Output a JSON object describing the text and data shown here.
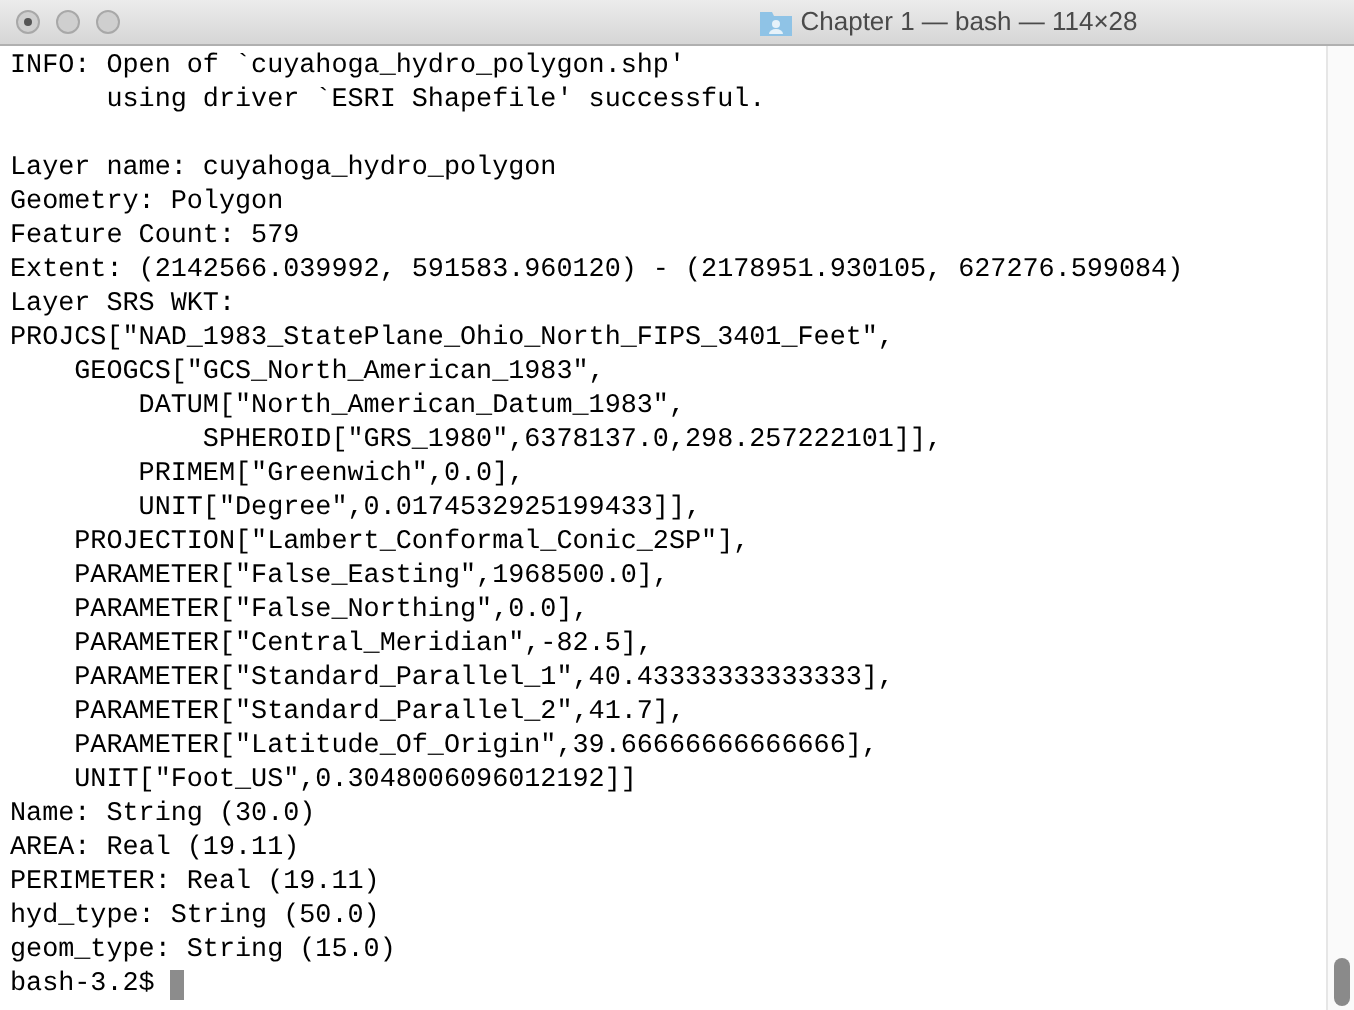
{
  "window": {
    "title": "Chapter 1 — bash — 114×28"
  },
  "terminal": {
    "blocks": [
      [
        "INFO: Open of `cuyahoga_hydro_polygon.shp'",
        "      using driver `ESRI Shapefile' successful."
      ],
      [
        "Layer name: cuyahoga_hydro_polygon",
        "Geometry: Polygon",
        "Feature Count: 579",
        "Extent: (2142566.039992, 591583.960120) - (2178951.930105, 627276.599084)",
        "Layer SRS WKT:",
        "PROJCS[\"NAD_1983_StatePlane_Ohio_North_FIPS_3401_Feet\",",
        "    GEOGCS[\"GCS_North_American_1983\",",
        "        DATUM[\"North_American_Datum_1983\",",
        "            SPHEROID[\"GRS_1980\",6378137.0,298.257222101]],",
        "        PRIMEM[\"Greenwich\",0.0],",
        "        UNIT[\"Degree\",0.0174532925199433]],",
        "    PROJECTION[\"Lambert_Conformal_Conic_2SP\"],",
        "    PARAMETER[\"False_Easting\",1968500.0],",
        "    PARAMETER[\"False_Northing\",0.0],",
        "    PARAMETER[\"Central_Meridian\",-82.5],",
        "    PARAMETER[\"Standard_Parallel_1\",40.43333333333333],",
        "    PARAMETER[\"Standard_Parallel_2\",41.7],",
        "    PARAMETER[\"Latitude_Of_Origin\",39.66666666666666],",
        "    UNIT[\"Foot_US\",0.3048006096012192]]",
        "Name: String (30.0)",
        "AREA: Real (19.11)",
        "PERIMETER: Real (19.11)",
        "hyd_type: String (50.0)",
        "geom_type: String (15.0)"
      ]
    ],
    "prompt": "bash-3.2$"
  }
}
